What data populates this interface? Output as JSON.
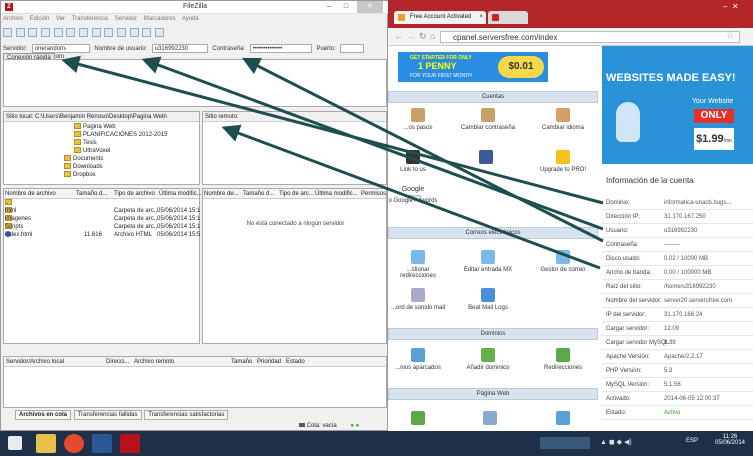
{
  "filezilla": {
    "title": "FileZilla",
    "menu": [
      "Archivo",
      "Edición",
      "Ver",
      "Transferencia",
      "Servidor",
      "Marcadores",
      "Ayuda"
    ],
    "quick": {
      "server_label": "Servidor:",
      "server_value": "onerandom-bugs3.com",
      "user_label": "Nombre de usuario:",
      "user_value": "u316992230",
      "pass_label": "Contraseña:",
      "pass_value": "••••••••••••••",
      "port_label": "Puerto:",
      "connect_label": "Conexión rápida"
    },
    "local_site_label": "Sitio local:",
    "local_site_value": "C:\\Users\\Benjamin Renoso\\Desktop\\Pagina Web\\",
    "remote_site_label": "Sitio remoto:",
    "tree": [
      "Pagina Web",
      "PLANIFICACIONES 2012-2015",
      "Tesis",
      "UltraVoxel",
      "Documents",
      "Downloads",
      "Dropbox"
    ],
    "local_cols": [
      "Nombre de archivo",
      "Tamaño d...",
      "Tipo de archivo",
      "Última modific..."
    ],
    "remote_cols": [
      "Nombre de...",
      "Tamaño d...",
      "Tipo de arc...",
      "Última modific...",
      "Permisos"
    ],
    "files": [
      {
        "name": "..",
        "size": "",
        "type": "",
        "date": ""
      },
      {
        "name": "html",
        "size": "",
        "type": "Carpeta de arc...",
        "date": "05/06/2014 15:1"
      },
      {
        "name": "imagenes",
        "size": "",
        "type": "Carpeta de arc...",
        "date": "05/06/2014 15:1"
      },
      {
        "name": "Scripts",
        "size": "",
        "type": "Carpeta de arc...",
        "date": "05/06/2014 15:1"
      },
      {
        "name": "index.html",
        "size": "11.616",
        "type": "Archivo HTML",
        "date": "05/06/2014 15:5"
      }
    ],
    "remote_empty": "No está conectado a ningún servidor",
    "queue_cols": [
      "Servidor/Archivo local",
      "Direcci...",
      "Archivo remoto",
      "Tamaño",
      "Prioridad",
      "Estado"
    ],
    "queue_tabs": [
      "Archivos en cola",
      "Transferencias fallidas",
      "Transferencias satisfactorias"
    ],
    "status": "Cola: vacía"
  },
  "chrome": {
    "tab1": "Free Account Activated",
    "tab2": "",
    "url": "cpanel.serversfree.com/index"
  },
  "cpanel": {
    "banner1": "GET STARTED FOR ONLY",
    "banner2": "1 PENNY",
    "banner3": "FOR YOUR FIRST MONTH",
    "banner_price": "$0.01",
    "sections": [
      "Cuentas",
      "Correos electrónicos",
      "Dominios",
      "Página Web"
    ],
    "icons_row1": [
      "...os pasos",
      "Cambiar contraseña",
      "Cambiar idioma"
    ],
    "icons_row2": [
      "Link to us",
      "",
      "Upgrade to PRO!"
    ],
    "google": "Google",
    "google_sub": "AdWords",
    "google_label": "o Google Adwords",
    "icons_row3": [
      "...stionar redirecciones",
      "Editar entrada MX",
      "Gestor de correo"
    ],
    "icons_row4": [
      "...ord de sonido mail",
      "Beat Mail Logs"
    ],
    "icons_row5": [
      "...nios aparcados",
      "Añadir dominios",
      "Redirecciones"
    ],
    "side_title": "WEBSITES MADE EASY!",
    "side_your": "Your Website",
    "side_only": "ONLY",
    "side_price": "$1.99",
    "side_per": "/mo",
    "info_title": "Información de la cuenta",
    "info": [
      {
        "l": "Dominio:",
        "v": "informatica-unacb.bugs..."
      },
      {
        "l": "Dirección IP:",
        "v": "31.170.167.250"
      },
      {
        "l": "Usuario:",
        "v": "u316992230"
      },
      {
        "l": "Contraseña",
        "v": "--------"
      },
      {
        "l": "Disco usado:",
        "v": "0.02 / 10000 MB"
      },
      {
        "l": "Ancho de banda:",
        "v": "0.00 / 100000 MB"
      },
      {
        "l": "Raíz del sitio:",
        "v": "/home/u316992230"
      },
      {
        "l": "Nombre del servidor:",
        "v": "server20.serversfree.com"
      },
      {
        "l": "IP del servidor:",
        "v": "31.170.166.24"
      },
      {
        "l": "Cargar servidor:",
        "v": "12.09"
      },
      {
        "l": "Cargar servidor MySQL:",
        "v": "1.38"
      },
      {
        "l": "Apache Versión:",
        "v": "Apache/2.2.17"
      },
      {
        "l": "PHP Versión:",
        "v": "5.3"
      },
      {
        "l": "MySQL Versión:",
        "v": "5.1.56"
      },
      {
        "l": "Activado:",
        "v": "2014-06-05 12:00:37"
      },
      {
        "l": "Estado:",
        "v": "Activo"
      }
    ]
  },
  "taskbar": {
    "time": "11:26",
    "date": "05/06/2014",
    "lang": "ESP"
  },
  "colors": {
    "filezilla": "#b5121b",
    "chrome_tab": "#b5262a",
    "cpanel_blue": "#2a93d8",
    "taskbar": "#1e3148",
    "arrow": "#1f4e4e"
  }
}
